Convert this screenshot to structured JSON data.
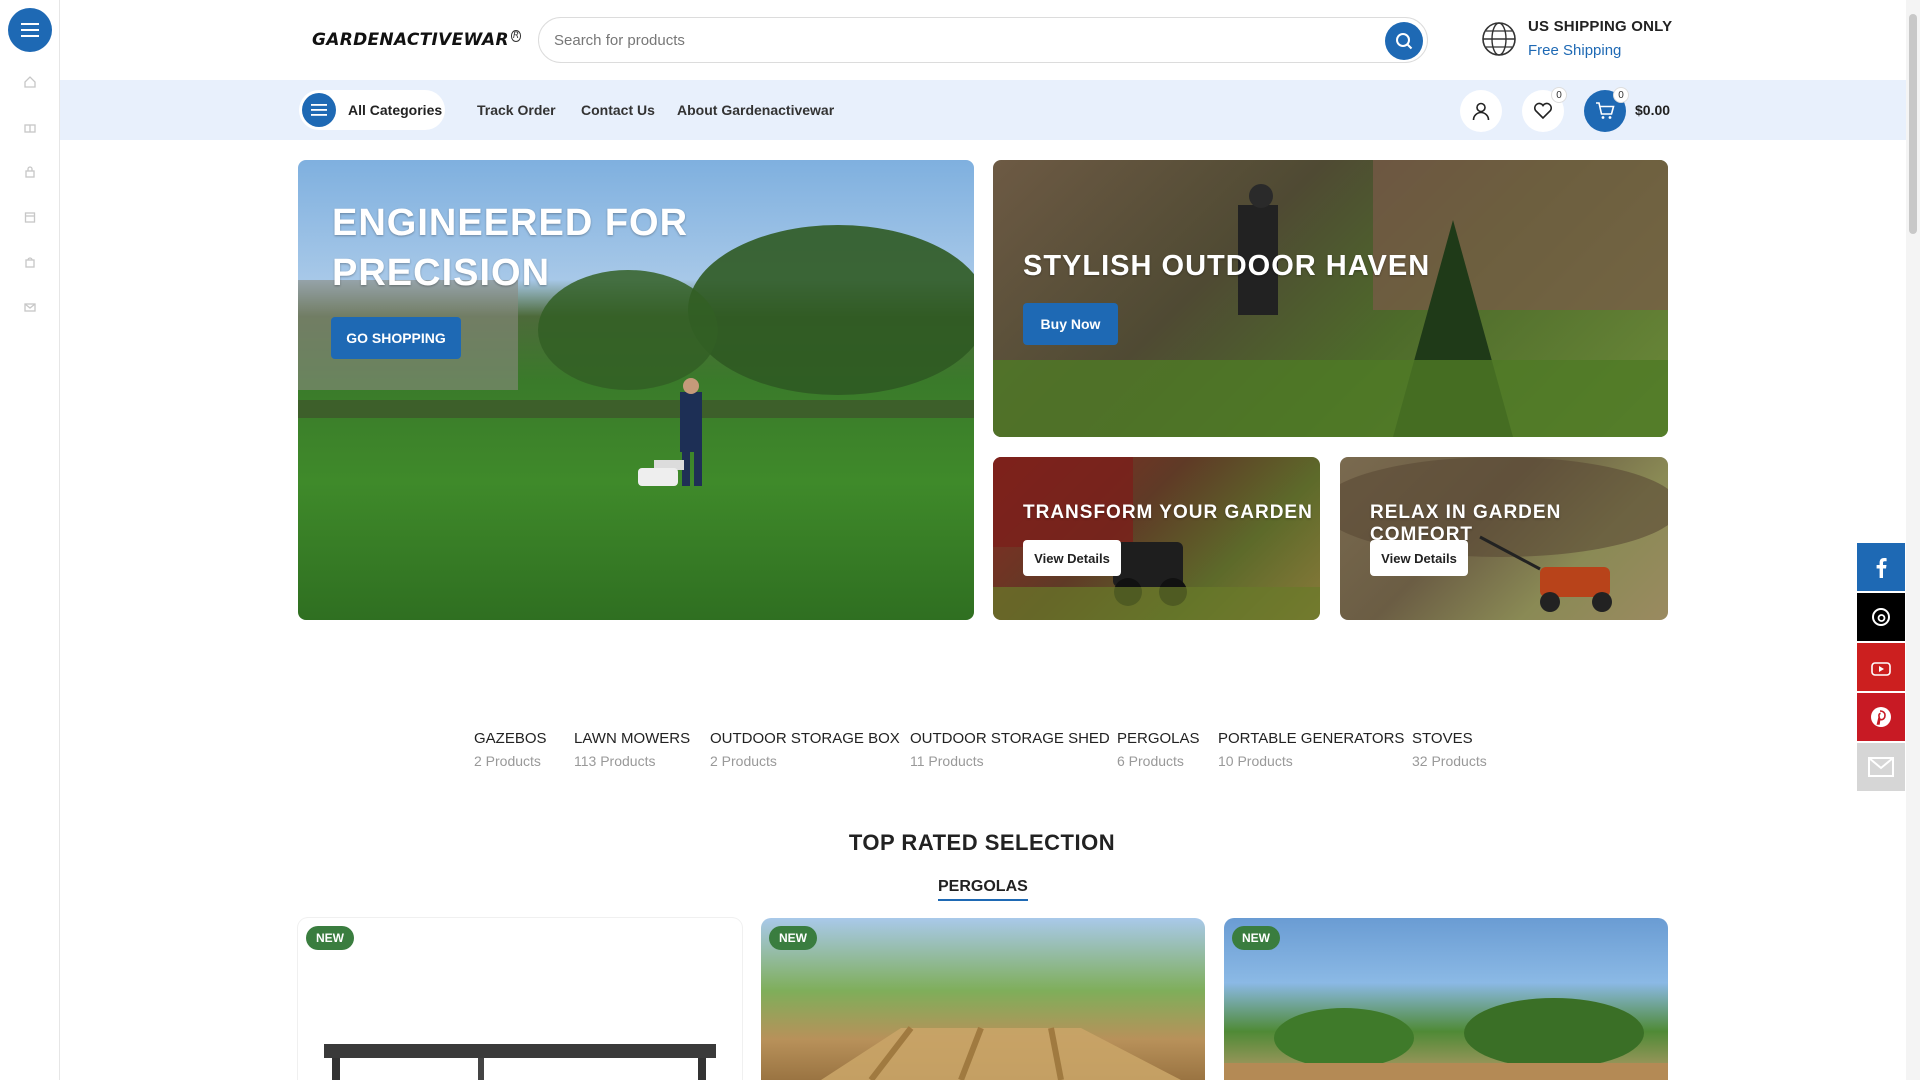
{
  "brand": {
    "logo_text": "GARDENACTIVEWAR",
    "accent_color": "#1e69b4"
  },
  "rail": {
    "icons": [
      "home-icon",
      "gift-icon",
      "lock-icon",
      "calendar-icon",
      "bag-icon",
      "mail-icon"
    ]
  },
  "search": {
    "placeholder": "Search for products"
  },
  "shipping": {
    "title": "US SHIPPING ONLY",
    "subtitle": "Free Shipping"
  },
  "nav": {
    "all_categories": "All Categories",
    "links": [
      "Track Order",
      "Contact Us",
      "About Gardenactivewar"
    ],
    "wishlist_count": "0",
    "cart_count": "0",
    "cart_total": "$0.00"
  },
  "banners": [
    {
      "title": "ENGINEERED FOR PRECISION",
      "button": "GO SHOPPING"
    },
    {
      "title": "STYLISH OUTDOOR HAVEN",
      "button": "Buy Now"
    },
    {
      "title": "TRANSFORM YOUR GARDEN",
      "button": "View Details"
    },
    {
      "title": "RELAX IN GARDEN COMFORT",
      "button": "View Details"
    }
  ],
  "categories": [
    {
      "name": "GAZEBOS",
      "count": "2 Products"
    },
    {
      "name": "LAWN MOWERS",
      "count": "113 Products"
    },
    {
      "name": "OUTDOOR STORAGE BOX",
      "count": "2 Products"
    },
    {
      "name": "OUTDOOR STORAGE SHED",
      "count": "11 Products"
    },
    {
      "name": "PERGOLAS",
      "count": "6 Products"
    },
    {
      "name": "PORTABLE GENERATORS",
      "count": "10 Products"
    },
    {
      "name": "STOVES",
      "count": "32 Products"
    }
  ],
  "section": {
    "title": "TOP RATED SELECTION",
    "tab": "PERGOLAS"
  },
  "products": [
    {
      "badge": "NEW"
    },
    {
      "badge": "NEW"
    },
    {
      "badge": "NEW"
    }
  ],
  "social": [
    {
      "name": "facebook-icon",
      "color": "#1e69b4"
    },
    {
      "name": "threads-icon",
      "color": "#000000"
    },
    {
      "name": "youtube-icon",
      "color": "#cc1f1f"
    },
    {
      "name": "pinterest-icon",
      "color": "#c81a24"
    },
    {
      "name": "mail-icon",
      "color": "#d6d6d6"
    }
  ]
}
